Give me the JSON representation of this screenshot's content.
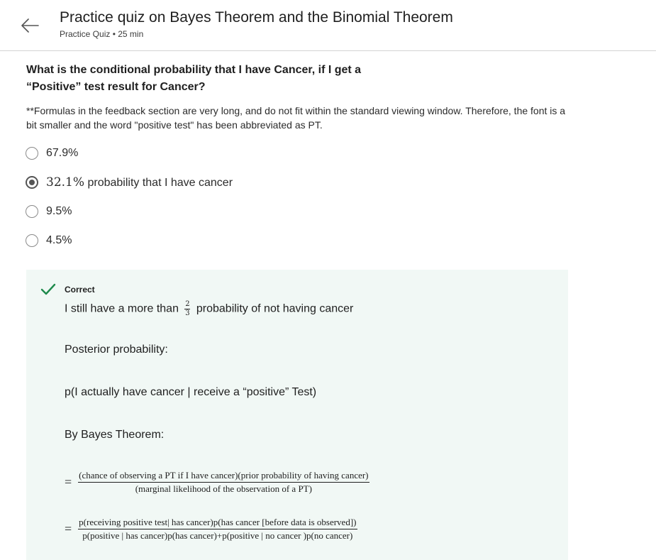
{
  "header": {
    "title": "Practice quiz on Bayes Theorem and the Binomial Theorem",
    "subtitle": "Practice Quiz • 25 min"
  },
  "question": {
    "text": "What is the conditional probability that I have Cancer, if I get a “Positive” test result for Cancer?",
    "note": "**Formulas in the feedback section are very long, and do not fit within the standard viewing window. Therefore, the font is a bit smaller and the word \"positive test\" has been abbreviated as PT."
  },
  "options": [
    {
      "label": "67.9%",
      "selected": false
    },
    {
      "math": "32.1%",
      "label": " probability that I have cancer",
      "selected": true
    },
    {
      "label": "9.5%",
      "selected": false
    },
    {
      "label": "4.5%",
      "selected": false
    }
  ],
  "feedback": {
    "status": "Correct",
    "line1_before": "I still have a more than",
    "frac_num": "2",
    "frac_den": "3",
    "line1_after": "probability of not having cancer",
    "posterior_label": "Posterior probability:",
    "posterior_expr": "p(I actually have cancer | receive a “positive” Test)",
    "bayes_label": "By Bayes Theorem:",
    "eq_sign": "=",
    "eq1_num": "(chance of observing a PT if I have cancer)(prior probability of having cancer)",
    "eq1_den": "(marginal likelihood of the observation of a PT)",
    "eq2_num": "p(receiving positive test| has cancer)p(has cancer [before data is observed])",
    "eq2_den": "p(positive | has cancer)p(has cancer)+p(positive | no cancer )p(no cancer)"
  },
  "colors": {
    "feedback_bg": "#f1f8f5",
    "check": "#1e8a4c",
    "text": "#1f1f1f"
  }
}
